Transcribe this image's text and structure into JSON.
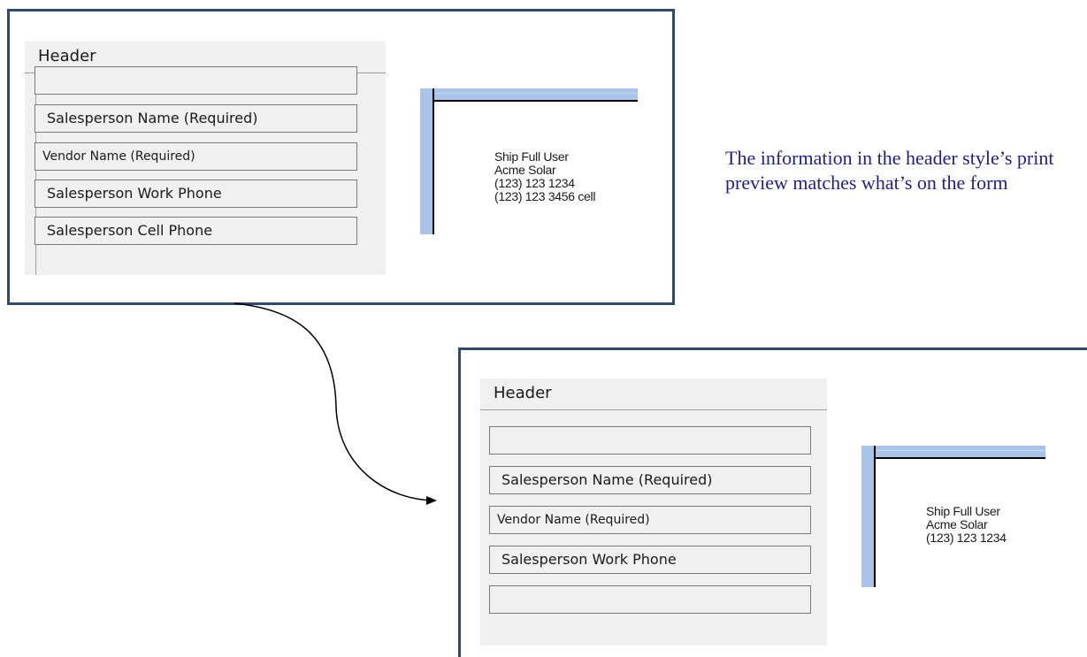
{
  "top_example": {
    "panel_title": "Header",
    "fields": [
      "",
      "Salesperson Name  (Required)",
      "Vendor Name  (Required)",
      "Salesperson Work Phone",
      "Salesperson Cell Phone"
    ],
    "preview_lines": [
      "Ship Full User",
      "Acme Solar",
      "(123) 123 1234",
      "(123) 123 3456 cell"
    ]
  },
  "bottom_example": {
    "panel_title": "Header",
    "fields": [
      "",
      "Salesperson Name  (Required)",
      "Vendor Name  (Required)",
      "Salesperson Work Phone",
      ""
    ],
    "preview_lines": [
      "Ship Full User",
      "Acme Solar",
      "(123) 123 1234"
    ]
  },
  "caption": "The information in the header style’s print preview matches what’s on the form",
  "colors": {
    "frame_border": "#2e4a6e",
    "panel_bg": "#f0f0f0",
    "preview_band": "#a9c4e9",
    "caption_text": "#1f1f8a"
  },
  "icons": [
    "curved-arrow-connector"
  ]
}
